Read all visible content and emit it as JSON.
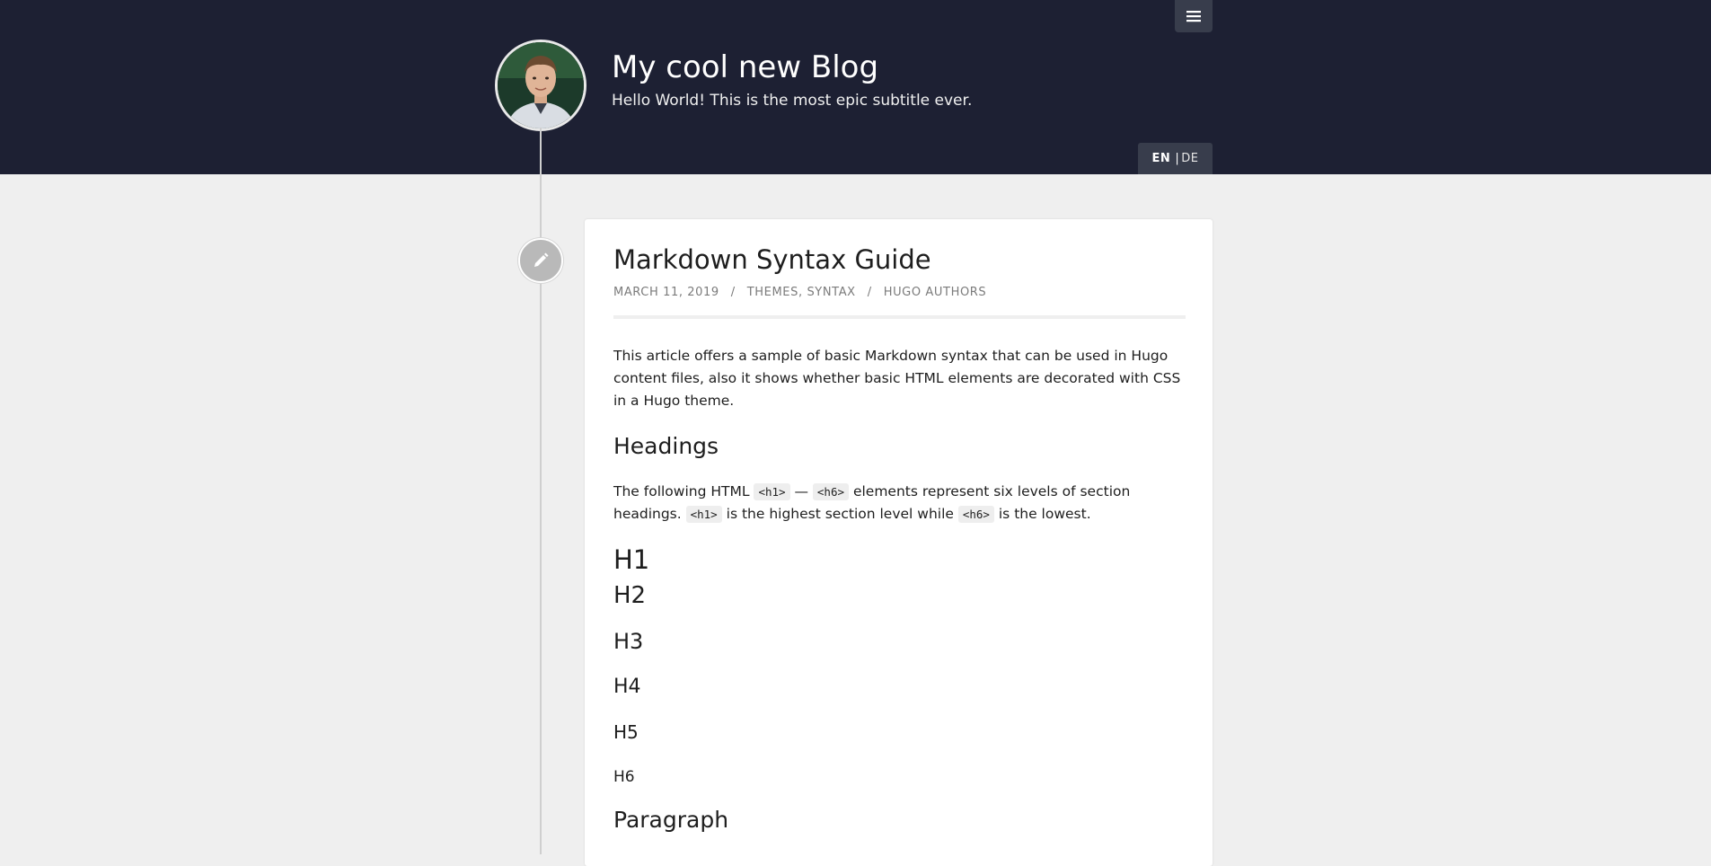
{
  "header": {
    "menu_icon": "hamburger-menu-icon",
    "blog_title": "My cool new Blog",
    "blog_subtitle": "Hello World! This is the most epic subtitle ever.",
    "languages": {
      "active": "EN",
      "separator": "|",
      "other": "DE"
    }
  },
  "post": {
    "edit_icon": "pencil-icon",
    "title": "Markdown Syntax Guide",
    "meta": {
      "date": "MARCH 11, 2019",
      "sep1": "/",
      "categories": "THEMES, SYNTAX",
      "sep2": "/",
      "author": "HUGO AUTHORS"
    },
    "intro": "This article offers a sample of basic Markdown syntax that can be used in Hugo content files, also it shows whether basic HTML elements are decorated with CSS in a Hugo theme.",
    "headings_title": "Headings",
    "headings_para": {
      "t1": "The following HTML ",
      "c1": "<h1>",
      "t2": " — ",
      "c2": "<h6>",
      "t3": " elements represent six levels of section headings. ",
      "c3": "<h1>",
      "t4": " is the highest section level while ",
      "c4": "<h6>",
      "t5": " is the lowest."
    },
    "h1": "H1",
    "h2": "H2",
    "h3": "H3",
    "h4": "H4",
    "h5": "H5",
    "h6": "H6",
    "paragraph_title": "Paragraph"
  },
  "colors": {
    "header_bg": "#1d2033",
    "page_bg": "#efefef",
    "card_bg": "#ffffff",
    "meta_text": "#7b7b7b"
  }
}
